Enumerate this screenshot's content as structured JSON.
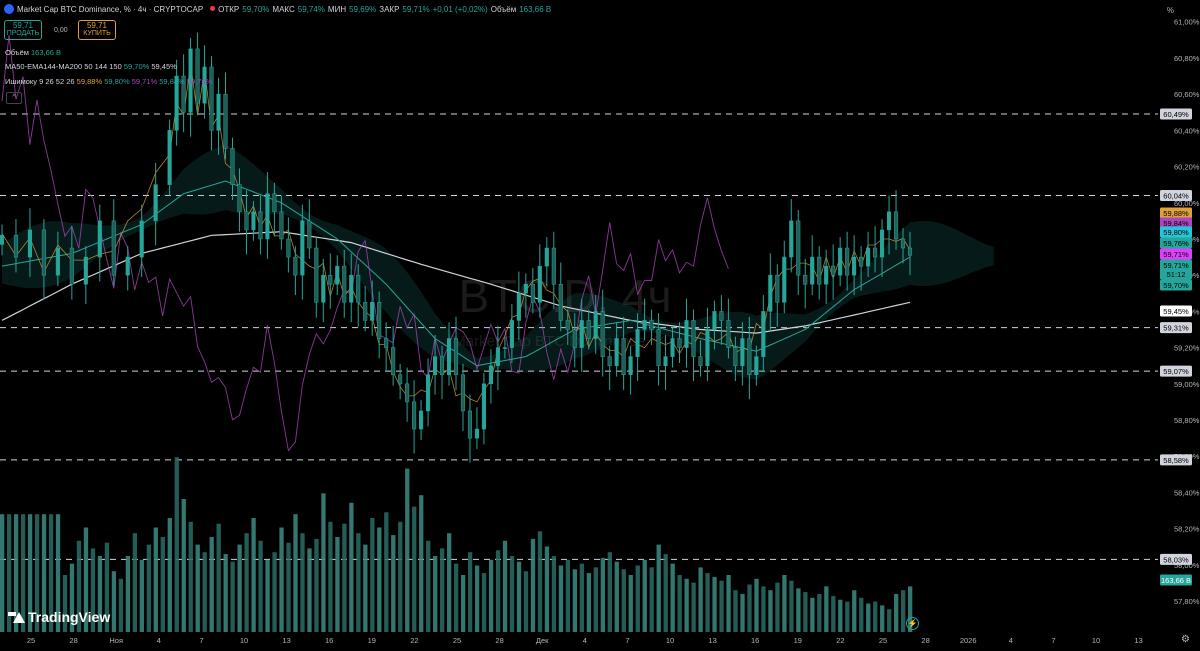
{
  "header": {
    "symbol": "Market Cap BTC Dominance, % · 4ч · CRYPTOCAP",
    "open_label": "ОТКР",
    "open": "59,70%",
    "high_label": "МАКС",
    "high": "59,74%",
    "low_label": "МИН",
    "low": "59,69%",
    "close_label": "ЗАКР",
    "close": "59,71%",
    "change": "+0,01 (+0,02%)",
    "volume_label": "Объём",
    "volume": "163,66 B"
  },
  "trade": {
    "sell_price": "59,71",
    "sell_label": "ПРОДАТЬ",
    "spread": "0,00",
    "buy_price": "59,71",
    "buy_label": "КУПИТЬ"
  },
  "indicators": {
    "volume_label": "Объём",
    "volume_value": "163,66 B",
    "ma_label": "MA50-EMA144-MA200 50 144 150",
    "ma_v1": "59,70%",
    "ma_v2": "59,45%",
    "ichi_label": "Ишимоку 9 26 52 26",
    "ichi_v1": "59,88%",
    "ichi_v2": "59,80%",
    "ichi_v3": "59,71%",
    "ichi_v4": "59,84%",
    "ichi_v5": "59,76%",
    "collapse": "^"
  },
  "watermark": {
    "main": "BTC.D, 4ч",
    "sub": "Market Cap BTC Dominance, %"
  },
  "axis_unit": "%",
  "brand": "TradingView",
  "settings_icon": "gear-icon",
  "colors": {
    "up": "#26a69a",
    "down": "#26a69a",
    "ma50": "#26a69a",
    "ema144": "#d1d4dc",
    "ma200": "#e0a03a",
    "tenkan": "#e0a03a",
    "kijun": "#26a69a",
    "chikou": "#ab47bc",
    "cloud_up": "#26a69a",
    "cloud_down": "#ab47bc"
  },
  "chart_data": {
    "type": "candlestick",
    "title": "Market Cap BTC Dominance, % · 4ч · CRYPTOCAP",
    "ylim": [
      57.64,
      61.12
    ],
    "y_ticks": [
      "61,00%",
      "60,80%",
      "60,60%",
      "60,40%",
      "60,20%",
      "60,00%",
      "59,80%",
      "59,60%",
      "59,40%",
      "59,20%",
      "59,00%",
      "58,80%",
      "58,60%",
      "58,40%",
      "58,20%",
      "58,00%",
      "57,80%"
    ],
    "x_ticks": [
      "25",
      "28",
      "Ноя",
      "4",
      "7",
      "10",
      "13",
      "16",
      "19",
      "22",
      "25",
      "28",
      "Дек",
      "4",
      "7",
      "10",
      "13",
      "16",
      "19",
      "22",
      "25",
      "28",
      "2026",
      "4",
      "7",
      "10",
      "13"
    ],
    "horizontal_levels": [
      {
        "value": 60.49,
        "label": "60,49%"
      },
      {
        "value": 60.04,
        "label": "60,04%"
      },
      {
        "value": 59.31,
        "label": "59,31%"
      },
      {
        "value": 59.07,
        "label": "59,07%"
      },
      {
        "value": 58.58,
        "label": "58,58%"
      },
      {
        "value": 58.03,
        "label": "58,03%"
      }
    ],
    "price_path": [
      [
        0,
        59.82
      ],
      [
        2,
        59.7
      ],
      [
        4,
        59.85
      ],
      [
        6,
        59.6
      ],
      [
        8,
        59.75
      ],
      [
        10,
        59.55
      ],
      [
        12,
        59.7
      ],
      [
        14,
        59.9
      ],
      [
        16,
        59.6
      ],
      [
        18,
        59.7
      ],
      [
        20,
        59.9
      ],
      [
        22,
        60.1
      ],
      [
        24,
        60.4
      ],
      [
        25,
        60.7
      ],
      [
        26,
        60.5
      ],
      [
        27,
        60.85
      ],
      [
        28,
        60.55
      ],
      [
        29,
        60.75
      ],
      [
        30,
        60.4
      ],
      [
        31,
        60.6
      ],
      [
        32,
        60.3
      ],
      [
        33,
        60.1
      ],
      [
        34,
        59.95
      ],
      [
        35,
        59.85
      ],
      [
        36,
        59.95
      ],
      [
        37,
        59.8
      ],
      [
        38,
        60.05
      ],
      [
        39,
        59.95
      ],
      [
        40,
        59.8
      ],
      [
        41,
        59.7
      ],
      [
        42,
        59.6
      ],
      [
        43,
        59.9
      ],
      [
        44,
        59.75
      ],
      [
        45,
        59.45
      ],
      [
        46,
        59.6
      ],
      [
        47,
        59.55
      ],
      [
        48,
        59.65
      ],
      [
        49,
        59.45
      ],
      [
        50,
        59.6
      ],
      [
        51,
        59.45
      ],
      [
        52,
        59.35
      ],
      [
        53,
        59.45
      ],
      [
        54,
        59.25
      ],
      [
        55,
        59.2
      ],
      [
        56,
        59.05
      ],
      [
        57,
        59.0
      ],
      [
        58,
        58.9
      ],
      [
        59,
        58.75
      ],
      [
        60,
        58.85
      ],
      [
        61,
        59.05
      ],
      [
        62,
        59.15
      ],
      [
        63,
        59.05
      ],
      [
        64,
        59.25
      ],
      [
        65,
        59.05
      ],
      [
        66,
        58.85
      ],
      [
        67,
        58.7
      ],
      [
        68,
        58.75
      ],
      [
        69,
        59.0
      ],
      [
        70,
        59.1
      ],
      [
        71,
        59.2
      ],
      [
        72,
        59.2
      ],
      [
        73,
        59.35
      ],
      [
        74,
        59.5
      ],
      [
        75,
        59.55
      ],
      [
        76,
        59.45
      ],
      [
        77,
        59.65
      ],
      [
        78,
        59.75
      ],
      [
        79,
        59.55
      ],
      [
        80,
        59.35
      ],
      [
        81,
        59.3
      ],
      [
        82,
        59.2
      ],
      [
        83,
        59.35
      ],
      [
        84,
        59.25
      ],
      [
        85,
        59.4
      ],
      [
        86,
        59.15
      ],
      [
        87,
        59.1
      ],
      [
        88,
        59.25
      ],
      [
        89,
        59.05
      ],
      [
        90,
        59.15
      ],
      [
        91,
        59.3
      ],
      [
        92,
        59.35
      ],
      [
        93,
        59.3
      ],
      [
        94,
        59.1
      ],
      [
        95,
        59.15
      ],
      [
        96,
        59.25
      ],
      [
        97,
        59.2
      ],
      [
        98,
        59.35
      ],
      [
        99,
        59.15
      ],
      [
        100,
        59.1
      ],
      [
        101,
        59.3
      ],
      [
        102,
        59.4
      ],
      [
        103,
        59.35
      ],
      [
        104,
        59.2
      ],
      [
        105,
        59.1
      ],
      [
        106,
        59.25
      ],
      [
        107,
        59.05
      ],
      [
        108,
        59.15
      ],
      [
        109,
        59.4
      ],
      [
        110,
        59.6
      ],
      [
        111,
        59.45
      ],
      [
        112,
        59.7
      ],
      [
        113,
        59.9
      ],
      [
        114,
        59.6
      ],
      [
        115,
        59.55
      ],
      [
        116,
        59.7
      ],
      [
        117,
        59.55
      ],
      [
        118,
        59.65
      ],
      [
        119,
        59.6
      ],
      [
        120,
        59.75
      ],
      [
        121,
        59.6
      ],
      [
        122,
        59.7
      ],
      [
        123,
        59.65
      ],
      [
        124,
        59.75
      ],
      [
        125,
        59.7
      ],
      [
        126,
        59.85
      ],
      [
        127,
        59.95
      ],
      [
        128,
        59.8
      ],
      [
        129,
        59.75
      ],
      [
        130,
        59.71
      ]
    ],
    "ema144_path": [
      [
        0,
        59.35
      ],
      [
        10,
        59.55
      ],
      [
        20,
        59.72
      ],
      [
        30,
        59.82
      ],
      [
        40,
        59.84
      ],
      [
        50,
        59.78
      ],
      [
        60,
        59.66
      ],
      [
        70,
        59.55
      ],
      [
        80,
        59.43
      ],
      [
        90,
        59.35
      ],
      [
        100,
        59.3
      ],
      [
        108,
        59.28
      ],
      [
        115,
        59.32
      ],
      [
        122,
        59.38
      ],
      [
        130,
        59.45
      ]
    ],
    "ma50_path": [
      [
        0,
        59.65
      ],
      [
        10,
        59.72
      ],
      [
        20,
        59.88
      ],
      [
        26,
        60.05
      ],
      [
        32,
        60.12
      ],
      [
        40,
        60.0
      ],
      [
        48,
        59.8
      ],
      [
        55,
        59.55
      ],
      [
        62,
        59.25
      ],
      [
        68,
        59.1
      ],
      [
        75,
        59.15
      ],
      [
        82,
        59.3
      ],
      [
        90,
        59.35
      ],
      [
        100,
        59.25
      ],
      [
        108,
        59.18
      ],
      [
        115,
        59.3
      ],
      [
        122,
        59.52
      ],
      [
        130,
        59.7
      ]
    ],
    "volume_bars": [
      0.62,
      0.62,
      0.62,
      0.62,
      0.62,
      0.62,
      0.62,
      0.62,
      0.62,
      0.3,
      0.36,
      0.48,
      0.55,
      0.44,
      0.4,
      0.47,
      0.32,
      0.28,
      0.4,
      0.52,
      0.38,
      0.46,
      0.55,
      0.5,
      0.6,
      0.92,
      0.7,
      0.58,
      0.46,
      0.42,
      0.5,
      0.57,
      0.41,
      0.37,
      0.46,
      0.52,
      0.6,
      0.48,
      0.38,
      0.42,
      0.55,
      0.47,
      0.62,
      0.52,
      0.44,
      0.49,
      0.73,
      0.58,
      0.5,
      0.57,
      0.68,
      0.52,
      0.46,
      0.6,
      0.55,
      0.63,
      0.51,
      0.58,
      0.86,
      0.66,
      0.72,
      0.48,
      0.4,
      0.44,
      0.52,
      0.36,
      0.3,
      0.42,
      0.35,
      0.31,
      0.38,
      0.43,
      0.48,
      0.4,
      0.37,
      0.32,
      0.49,
      0.53,
      0.45,
      0.4,
      0.35,
      0.38,
      0.33,
      0.36,
      0.31,
      0.34,
      0.39,
      0.42,
      0.37,
      0.33,
      0.3,
      0.35,
      0.38,
      0.34,
      0.46,
      0.41,
      0.36,
      0.3,
      0.28,
      0.26,
      0.34,
      0.31,
      0.29,
      0.27,
      0.3,
      0.22,
      0.2,
      0.25,
      0.28,
      0.24,
      0.22,
      0.26,
      0.3,
      0.27,
      0.23,
      0.21,
      0.18,
      0.2,
      0.24,
      0.19,
      0.17,
      0.16,
      0.22,
      0.18,
      0.15,
      0.16,
      0.14,
      0.12,
      0.2,
      0.22,
      0.24
    ],
    "last_value_tags": [
      {
        "label": "60,04%",
        "color": "#ffffff"
      },
      {
        "label": "59,88%",
        "color": "#e0a03a"
      },
      {
        "label": "59,84%",
        "color": "#ab47bc"
      },
      {
        "label": "59,80%",
        "color": "#26c6da"
      },
      {
        "label": "59,76%",
        "color": "#26a69a"
      },
      {
        "label": "59,71%",
        "color": "#e040fb"
      },
      {
        "label": "59,71%",
        "color": "#26a69a"
      },
      {
        "label": "51:12",
        "color": "#26a69a"
      },
      {
        "label": "59,70%",
        "color": "#26a69a"
      },
      {
        "label": "59,45%",
        "color": "#ffffff"
      }
    ],
    "volume_tag": "163,66 B"
  }
}
